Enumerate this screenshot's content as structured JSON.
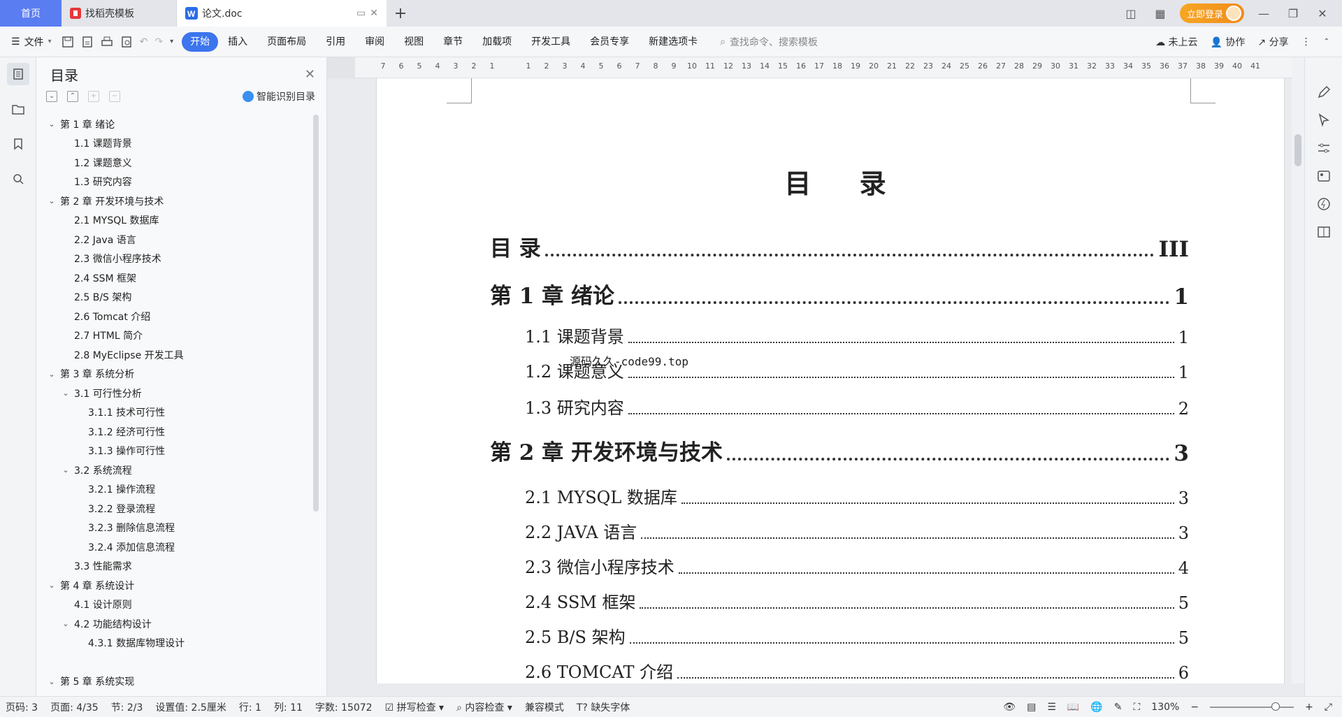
{
  "tabs": {
    "home": "首页",
    "template": "找稻壳模板",
    "document": "论文.doc",
    "login": "立即登录"
  },
  "toolbar": {
    "file": "文件",
    "ribbon": [
      "开始",
      "插入",
      "页面布局",
      "引用",
      "审阅",
      "视图",
      "章节",
      "加载项",
      "开发工具",
      "会员专享",
      "新建选项卡"
    ],
    "search_placeholder": "查找命令、搜索模板",
    "cloud": "未上云",
    "collab": "协作",
    "share": "分享"
  },
  "nav": {
    "title": "目录",
    "smart": "智能识别目录",
    "items": [
      {
        "text": "第 1 章  绪论",
        "level": 0,
        "expanded": true
      },
      {
        "text": "1.1  课题背景",
        "level": 1
      },
      {
        "text": "1.2  课题意义",
        "level": 1
      },
      {
        "text": "1.3  研究内容",
        "level": 1
      },
      {
        "text": "第 2 章  开发环境与技术",
        "level": 0,
        "expanded": true
      },
      {
        "text": "2.1  MYSQL 数据库",
        "level": 1
      },
      {
        "text": "2.2 Java 语言",
        "level": 1
      },
      {
        "text": "2.3  微信小程序技术",
        "level": 1
      },
      {
        "text": "2.4 SSM 框架",
        "level": 1
      },
      {
        "text": "2.5 B/S 架构",
        "level": 1
      },
      {
        "text": "2.6 Tomcat  介绍",
        "level": 1
      },
      {
        "text": "2.7 HTML 简介",
        "level": 1
      },
      {
        "text": "2.8 MyEclipse 开发工具",
        "level": 1
      },
      {
        "text": "第 3 章  系统分析",
        "level": 0,
        "expanded": true
      },
      {
        "text": "3.1  可行性分析",
        "level": 1,
        "expanded": true
      },
      {
        "text": "3.1.1  技术可行性",
        "level": 2
      },
      {
        "text": "3.1.2  经济可行性",
        "level": 2
      },
      {
        "text": "3.1.3  操作可行性",
        "level": 2
      },
      {
        "text": "3.2  系统流程",
        "level": 1,
        "expanded": true
      },
      {
        "text": "3.2.1  操作流程",
        "level": 2
      },
      {
        "text": "3.2.2  登录流程",
        "level": 2
      },
      {
        "text": "3.2.3  删除信息流程",
        "level": 2
      },
      {
        "text": "3.2.4  添加信息流程",
        "level": 2
      },
      {
        "text": "3.3  性能需求",
        "level": 1
      },
      {
        "text": "第 4 章  系统设计",
        "level": 0,
        "expanded": true
      },
      {
        "text": "4.1  设计原则",
        "level": 1
      },
      {
        "text": "4.2  功能结构设计",
        "level": 1,
        "expanded": true
      },
      {
        "text": "4.3.1  数据库物理设计",
        "level": 2
      },
      {
        "text": "",
        "level": 0,
        "blank": true
      },
      {
        "text": "第 5 章  系统实现",
        "level": 0,
        "expanded": true
      }
    ]
  },
  "ruler": [
    "7",
    "6",
    "5",
    "4",
    "3",
    "2",
    "1",
    "",
    "1",
    "2",
    "3",
    "4",
    "5",
    "6",
    "7",
    "8",
    "9",
    "10",
    "11",
    "12",
    "13",
    "14",
    "15",
    "16",
    "17",
    "18",
    "19",
    "20",
    "21",
    "22",
    "23",
    "24",
    "25",
    "26",
    "27",
    "28",
    "29",
    "30",
    "31",
    "32",
    "33",
    "34",
    "35",
    "36",
    "37",
    "38",
    "39",
    "40",
    "41"
  ],
  "document": {
    "title": "目  录",
    "watermark": "源码久久-code99.top",
    "toc": [
      {
        "label": "目  录",
        "page": "III",
        "kind": "h1"
      },
      {
        "label": "第 1 章  绪论",
        "page": "1",
        "kind": "h1"
      },
      {
        "label": "1.1  课题背景",
        "page": "1",
        "kind": "h2"
      },
      {
        "label": "1.2  课题意义",
        "page": "1",
        "kind": "h2"
      },
      {
        "label": "1.3  研究内容",
        "page": "2",
        "kind": "h2"
      },
      {
        "label": "第 2 章  开发环境与技术",
        "page": "3",
        "kind": "h1"
      },
      {
        "label": "2.1 MYSQL 数据库",
        "page": "3",
        "kind": "h2"
      },
      {
        "label": "2.2 JAVA 语言",
        "page": "3",
        "kind": "h2"
      },
      {
        "label": "2.3  微信小程序技术",
        "page": "4",
        "kind": "h2"
      },
      {
        "label": "2.4 SSM 框架",
        "page": "5",
        "kind": "h2"
      },
      {
        "label": "2.5 B/S 架构",
        "page": "5",
        "kind": "h2"
      },
      {
        "label": "2.6 TOMCAT  介绍",
        "page": "6",
        "kind": "h2"
      }
    ]
  },
  "status": {
    "page_code": "页码: 3",
    "page": "页面: 4/35",
    "section": "节: 2/3",
    "setting": "设置值: 2.5厘米",
    "row": "行: 1",
    "col": "列: 11",
    "words": "字数: 15072",
    "spell": "拼写检查",
    "content": "内容检查",
    "compat": "兼容模式",
    "missing_font": "缺失字体",
    "zoom": "130%"
  }
}
